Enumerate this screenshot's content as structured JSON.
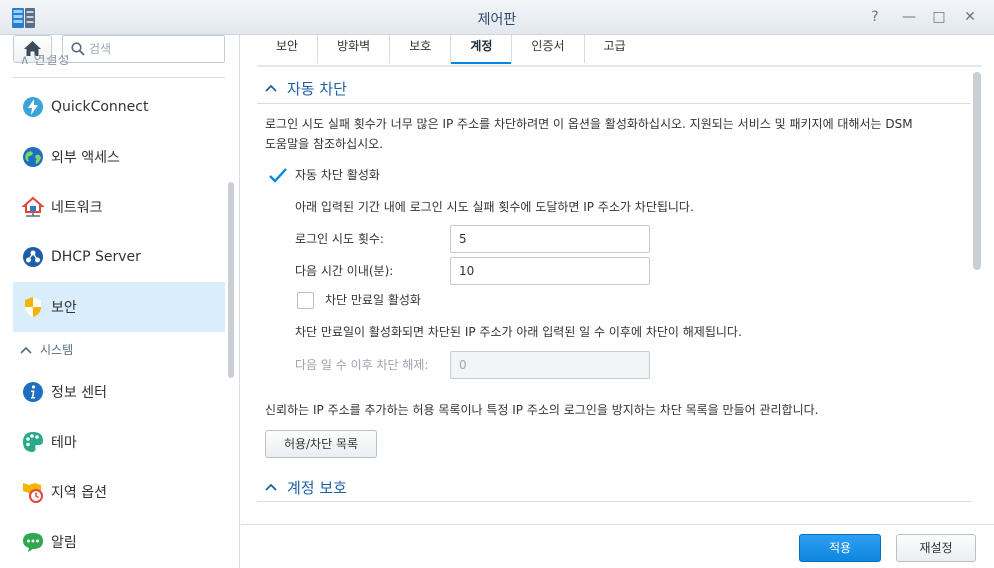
{
  "window": {
    "title": "제어판",
    "help_label": "?",
    "minimize_label": "—",
    "maximize_label": "□",
    "close_label": "✕"
  },
  "search": {
    "placeholder": "검색"
  },
  "sidebar": {
    "partial_category": "∧  연결성",
    "items": [
      {
        "label": "QuickConnect",
        "icon": "quickconnect-icon"
      },
      {
        "label": "외부 액세스",
        "icon": "globe-icon"
      },
      {
        "label": "네트워크",
        "icon": "network-icon"
      },
      {
        "label": "DHCP Server",
        "icon": "dhcp-icon"
      },
      {
        "label": "보안",
        "icon": "shield-icon",
        "active": true
      },
      {
        "label": "정보 센터",
        "icon": "info-icon"
      },
      {
        "label": "테마",
        "icon": "palette-icon"
      },
      {
        "label": "지역 옵션",
        "icon": "regional-clock-icon"
      },
      {
        "label": "알림",
        "icon": "chat-bubble-icon"
      }
    ],
    "category_system": "시스템"
  },
  "tabs": [
    "보안",
    "방화벽",
    "보호",
    "계정",
    "인증서",
    "고급"
  ],
  "active_tab": "계정",
  "auto_block": {
    "title": "자동 차단",
    "description_1": "로그인 시도 실패 횟수가 너무 많은 IP 주소를 차단하려면 이 옵션을 활성화하십시오. 지원되는 서비스 및 패키지에 대해서는 DSM",
    "description_2": "도움말을 참조하십시오.",
    "enable_label": "자동 차단 활성화",
    "enable_checked": true,
    "note": "아래 입력된 기간 내에 로그인 시도 실패 횟수에 도달하면 IP 주소가 차단됩니다.",
    "attempts_label": "로그인 시도 횟수:",
    "attempts_value": "5",
    "within_label": "다음 시간 이내(분):",
    "within_value": "10",
    "expiry_label": "차단 만료일 활성화",
    "expiry_checked": false,
    "expiry_note": "차단 만료일이 활성화되면 차단된 IP 주소가 아래 입력된 일 수 이후에 차단이 해제됩니다.",
    "unblock_label": "다음 일 수 이후 차단 해제:",
    "unblock_value": "0",
    "allow_block_note": "신뢰하는 IP 주소를 추가하는 허용 목록이나 특정 IP 주소의 로그인을 방지하는 차단 목록을 만들어 관리합니다.",
    "allow_block_button": "허용/차단 목록"
  },
  "account_protection": {
    "title": "계정 보호"
  },
  "footer": {
    "apply_label": "적용",
    "reset_label": "재설정"
  },
  "colors": {
    "accent": "#0086e5",
    "section_title": "#2060a5",
    "active_item_bg": "#d9edfd"
  }
}
